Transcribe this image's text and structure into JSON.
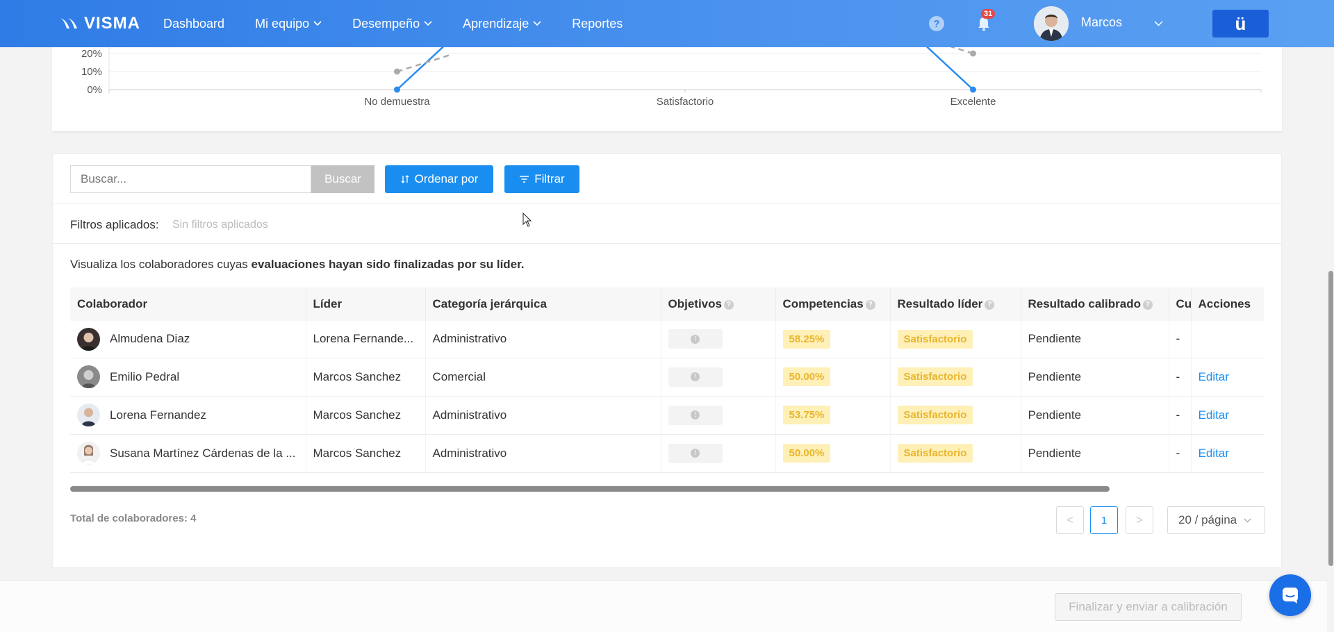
{
  "header": {
    "logo_text": "VISMA",
    "nav": [
      {
        "label": "Dashboard",
        "has_dropdown": false
      },
      {
        "label": "Mi equipo",
        "has_dropdown": true
      },
      {
        "label": "Desempeño",
        "has_dropdown": true
      },
      {
        "label": "Aprendizaje",
        "has_dropdown": true
      },
      {
        "label": "Reportes",
        "has_dropdown": false
      }
    ],
    "help_icon": "question-icon",
    "notifications_count": "31",
    "user_name": "Marcos",
    "u_button_label": "ü"
  },
  "chart_data": {
    "type": "line",
    "categories": [
      "",
      "No demuestra",
      "Satisfactorio",
      "Excelente",
      ""
    ],
    "y_ticks": [
      "0%",
      "10%",
      "20%"
    ],
    "series": [
      {
        "values": [
          null,
          0,
          null,
          0,
          null
        ],
        "color": "#2a8cf0",
        "style": "solid"
      },
      {
        "values": [
          null,
          10,
          null,
          20,
          null
        ],
        "color": "#aaaaaa",
        "style": "dashed"
      }
    ],
    "ylim": [
      0,
      20
    ],
    "grid": true
  },
  "toolbar": {
    "search_placeholder": "Buscar...",
    "search_button": "Buscar",
    "order_button": "Ordenar por",
    "filter_button": "Filtrar"
  },
  "filters": {
    "label": "Filtros aplicados:",
    "none": "Sin filtros aplicados"
  },
  "description": {
    "prefix": "Visualiza los colaboradores cuyas ",
    "bold": "evaluaciones hayan sido finalizadas por su líder."
  },
  "table": {
    "headers": {
      "colaborador": "Colaborador",
      "lider": "Líder",
      "categoria": "Categoría jerárquica",
      "objetivos": "Objetivos",
      "competencias": "Competencias",
      "resultado_lider": "Resultado líder",
      "resultado_calibrado": "Resultado calibrado",
      "cu": "Cu",
      "acciones": "Acciones"
    },
    "rows": [
      {
        "colaborador": "Almudena Diaz",
        "lider": "Lorena Fernande...",
        "categoria": "Administrativo",
        "competencias": "58.25%",
        "resultado_lider": "Satisfactorio",
        "resultado_calibrado": "Pendiente",
        "cu": "-",
        "accion": ""
      },
      {
        "colaborador": "Emilio Pedral",
        "lider": "Marcos Sanchez",
        "categoria": "Comercial",
        "competencias": "50.00%",
        "resultado_lider": "Satisfactorio",
        "resultado_calibrado": "Pendiente",
        "cu": "-",
        "accion": "Editar"
      },
      {
        "colaborador": "Lorena Fernandez",
        "lider": "Marcos Sanchez",
        "categoria": "Administrativo",
        "competencias": "53.75%",
        "resultado_lider": "Satisfactorio",
        "resultado_calibrado": "Pendiente",
        "cu": "-",
        "accion": "Editar"
      },
      {
        "colaborador": "Susana Martínez Cárdenas de la ...",
        "lider": "Marcos Sanchez",
        "categoria": "Administrativo",
        "competencias": "50.00%",
        "resultado_lider": "Satisfactorio",
        "resultado_calibrado": "Pendiente",
        "cu": "-",
        "accion": "Editar"
      }
    ]
  },
  "footer_list": {
    "total_label": "Total de colaboradores: 4",
    "prev": "<",
    "current_page": "1",
    "next": ">",
    "page_size": "20 / página"
  },
  "footer": {
    "finalize_button": "Finalizar y enviar a calibración"
  }
}
